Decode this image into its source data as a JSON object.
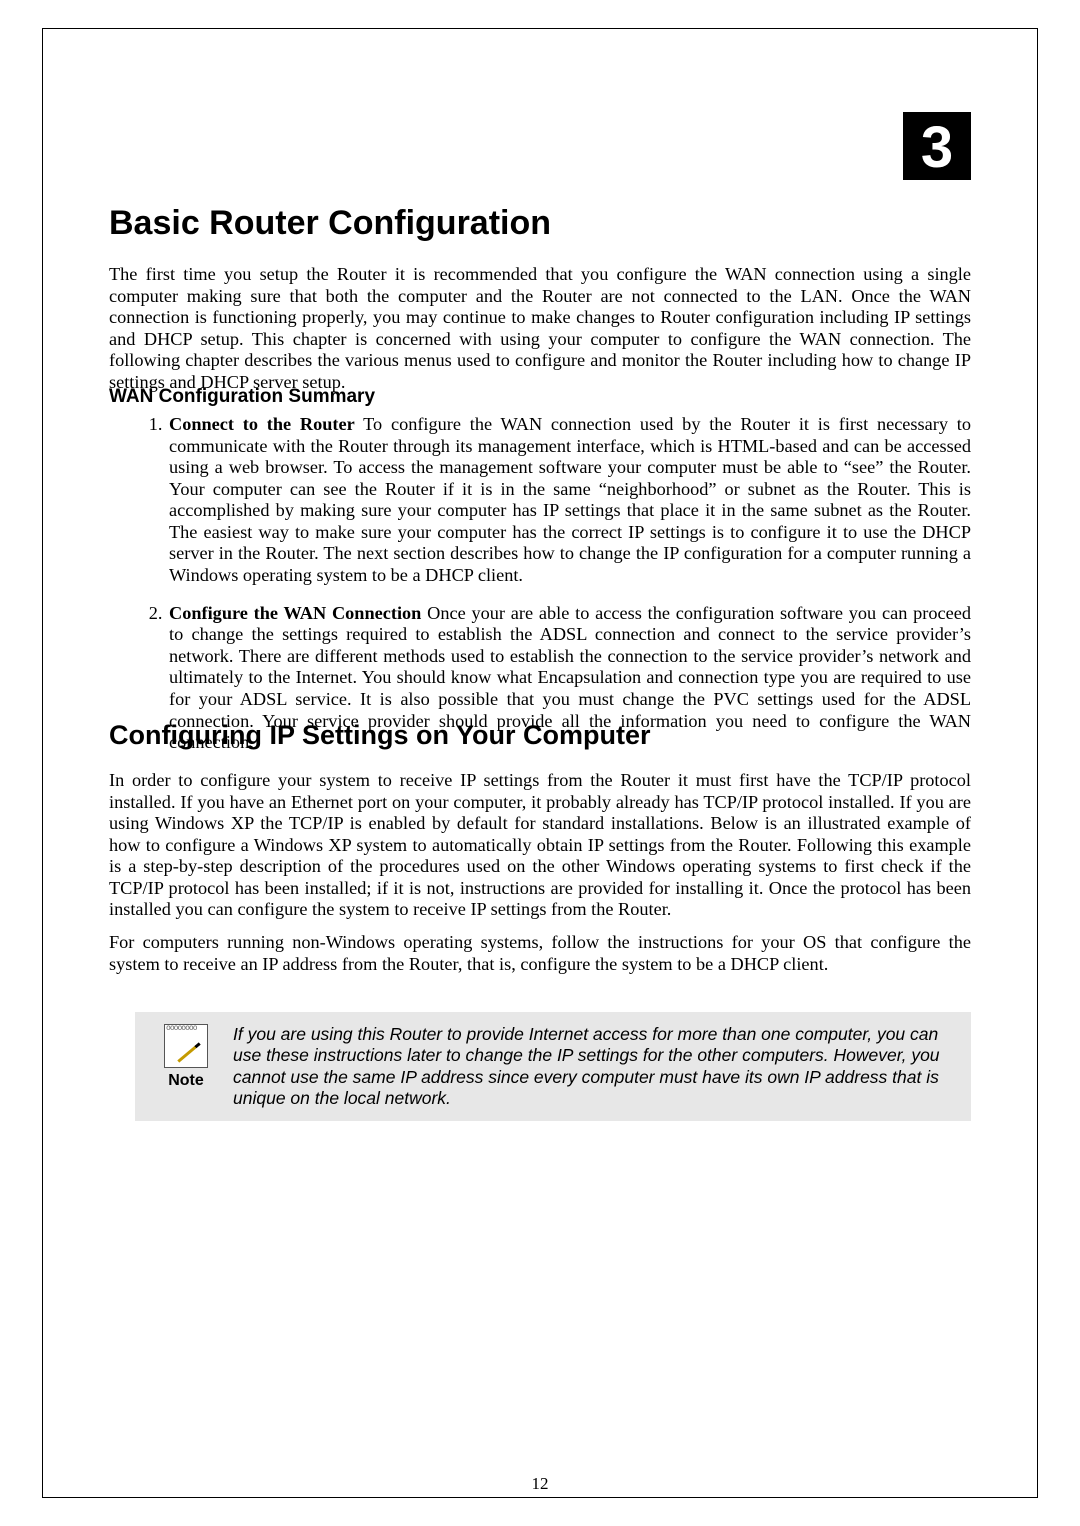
{
  "chapter_number": "3",
  "title": "Basic Router Configuration",
  "intro": "The first time you setup the Router it is recommended that you configure the WAN connection using a single computer making sure that both the computer and the Router are not connected to the LAN. Once the WAN connection is functioning properly, you may continue to make changes to Router configuration including IP settings and DHCP setup. This chapter is concerned with using your computer to configure the WAN connection. The following chapter describes the various menus used to configure and monitor the Router including how to change IP settings and DHCP server setup.",
  "wan_summary_heading": "WAN Configuration Summary",
  "steps": [
    {
      "lead": "Connect to the Router",
      "body": " To configure the WAN connection used by the Router it is first necessary to communicate with the Router through its management interface, which is HTML-based and can be accessed using a web browser. To access the management software your computer must be able to “see” the Router. Your computer can see the Router if it is in the same “neighborhood” or subnet as the Router. This is accomplished by making sure your computer has IP settings that place it in the same subnet as the Router. The easiest way to make sure your computer has the correct IP settings is to configure it to use the DHCP server in the Router. The next section describes how to change the IP configuration for a computer running a Windows operating system to be a DHCP client."
    },
    {
      "lead": "Configure the WAN Connection",
      "body": " Once your are able to access the configuration software you can proceed to change the settings required to establish the ADSL connection and connect to the service provider’s network. There are different methods used to establish the connection to the service provider’s network and ultimately to the Internet. You should know what Encapsulation and connection type you are required to use for your ADSL service. It is also possible that you must change the PVC settings used for the ADSL connection. Your service provider should provide all the information you need to configure the WAN connection."
    }
  ],
  "section2_heading": "Configuring IP Settings on Your Computer",
  "section2_para1": "In order to configure your system to receive IP settings from the Router it must first have the TCP/IP protocol installed. If you have an Ethernet port on your computer, it probably already has TCP/IP protocol installed. If you are using Windows XP the TCP/IP is enabled by default for standard installations. Below is an illustrated example of how to configure a Windows XP system to automatically obtain IP settings from the Router. Following this example is a step-by-step description of the procedures used on the other Windows operating systems to first check if the TCP/IP protocol has been installed; if it is not, instructions are provided for installing it. Once the protocol has been installed you can configure the system to receive IP settings from the Router.",
  "section2_para2": "For computers running non-Windows operating systems, follow the instructions for your OS that configure the system to receive an IP address from the Router, that is, configure the system to be a DHCP client.",
  "note": {
    "label": "Note",
    "text": "If you are using this Router to provide Internet access for more than one computer, you can use these instructions later to change the IP settings for the other computers. However, you cannot use the same IP address since every computer must have its own IP address that is unique on the local network."
  },
  "page_number": "12"
}
